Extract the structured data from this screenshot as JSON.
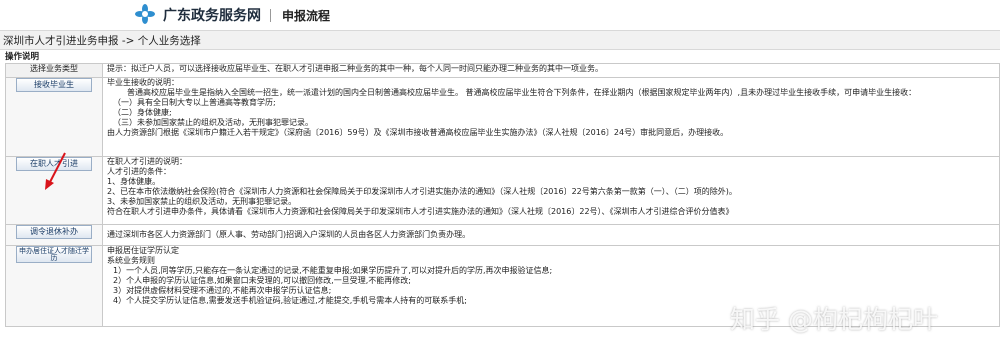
{
  "header": {
    "site_name": "广东政务服务网",
    "page_title": "申报流程"
  },
  "breadcrumb": "深圳市人才引进业务申报 -> 个人业务选择",
  "section_title": "操作说明",
  "table": {
    "head_label": "选择业务类型",
    "head_desc": "提示：拟迁户人员，可以选择接收应届毕业生、在职人才引进申报二种业务的其中一种，每个人同一时间只能办理二种业务的其中一项业务。",
    "rows": [
      {
        "button": "接收毕业生",
        "lines": [
          "毕业生接收的说明：",
          "普通高校应届毕业生是指纳入全国统一招生，统一派遣计划的国内全日制普通高校应届毕业生。 普通高校应届毕业生符合下列条件，在择业期内（根据国家规定毕业两年内）,且未办理过毕业生接收手续，可申请毕业生接收：",
          "（一）具有全日制大专以上普通高等教育学历;",
          "（二）身体健康;",
          "（三）未参加国家禁止的组织及活动，无刑事犯罪记录。",
          "由人力资源部门根据《深圳市户籍迁入若干规定》（深府函〔2016〕59号）及《深圳市接收普通高校应届毕业生实施办法》（深人社规〔2016〕24号）审批同意后，办理接收。"
        ]
      },
      {
        "button": "在职人才引进",
        "lines": [
          "在职人才引进的说明：",
          "人才引进的条件：",
          "1、身体健康。",
          "2、已在本市依法缴纳社会保险(符合《深圳市人力资源和社会保障局关于印发深圳市人才引进实施办法的通知》（深人社规〔2016〕22号第六条第一款第（一）、（二）项的除外)。",
          "3、未参加国家禁止的组织及活动，无刑事犯罪记录。",
          "符合在职人才引进申办条件，具体请看《深圳市人力资源和社会保障局关于印发深圳市人才引进实施办法的通知》（深人社规〔2016〕22号）、《深圳市人才引进综合评价分值表》"
        ]
      },
      {
        "button": "调令退休补办",
        "lines": [
          "通过深圳市各区人力资源部门（原人事、劳动部门)招调入户深圳的人员由各区人力资源部门负责办理。"
        ]
      },
      {
        "button": "申办居住证人才随迁学历",
        "lines": [
          "申报居住证学历认定",
          "系统业务规则",
          "1）一个人员,同等学历,只能存在一条认定通过的记录,不能重复申报;如果学历提升了,可以对提升后的学历,再次申报验证信息;",
          "2）个人申报的学历认证信息,如果窗口未受理的,可以撤回修改,一旦受理,不能再修改;",
          "3）对提供虚假材料受理不通过的,不能再次申报学历认证信息;",
          "4）个人提交学历认证信息,需要发送手机验证码,验证通过,才能提交,手机号需本人持有的可联系手机;"
        ]
      }
    ]
  },
  "watermark": "知乎 @枸杞枸杞叶",
  "colors": {
    "logo": "#2e8ecf",
    "arrow": "#d9141b"
  }
}
